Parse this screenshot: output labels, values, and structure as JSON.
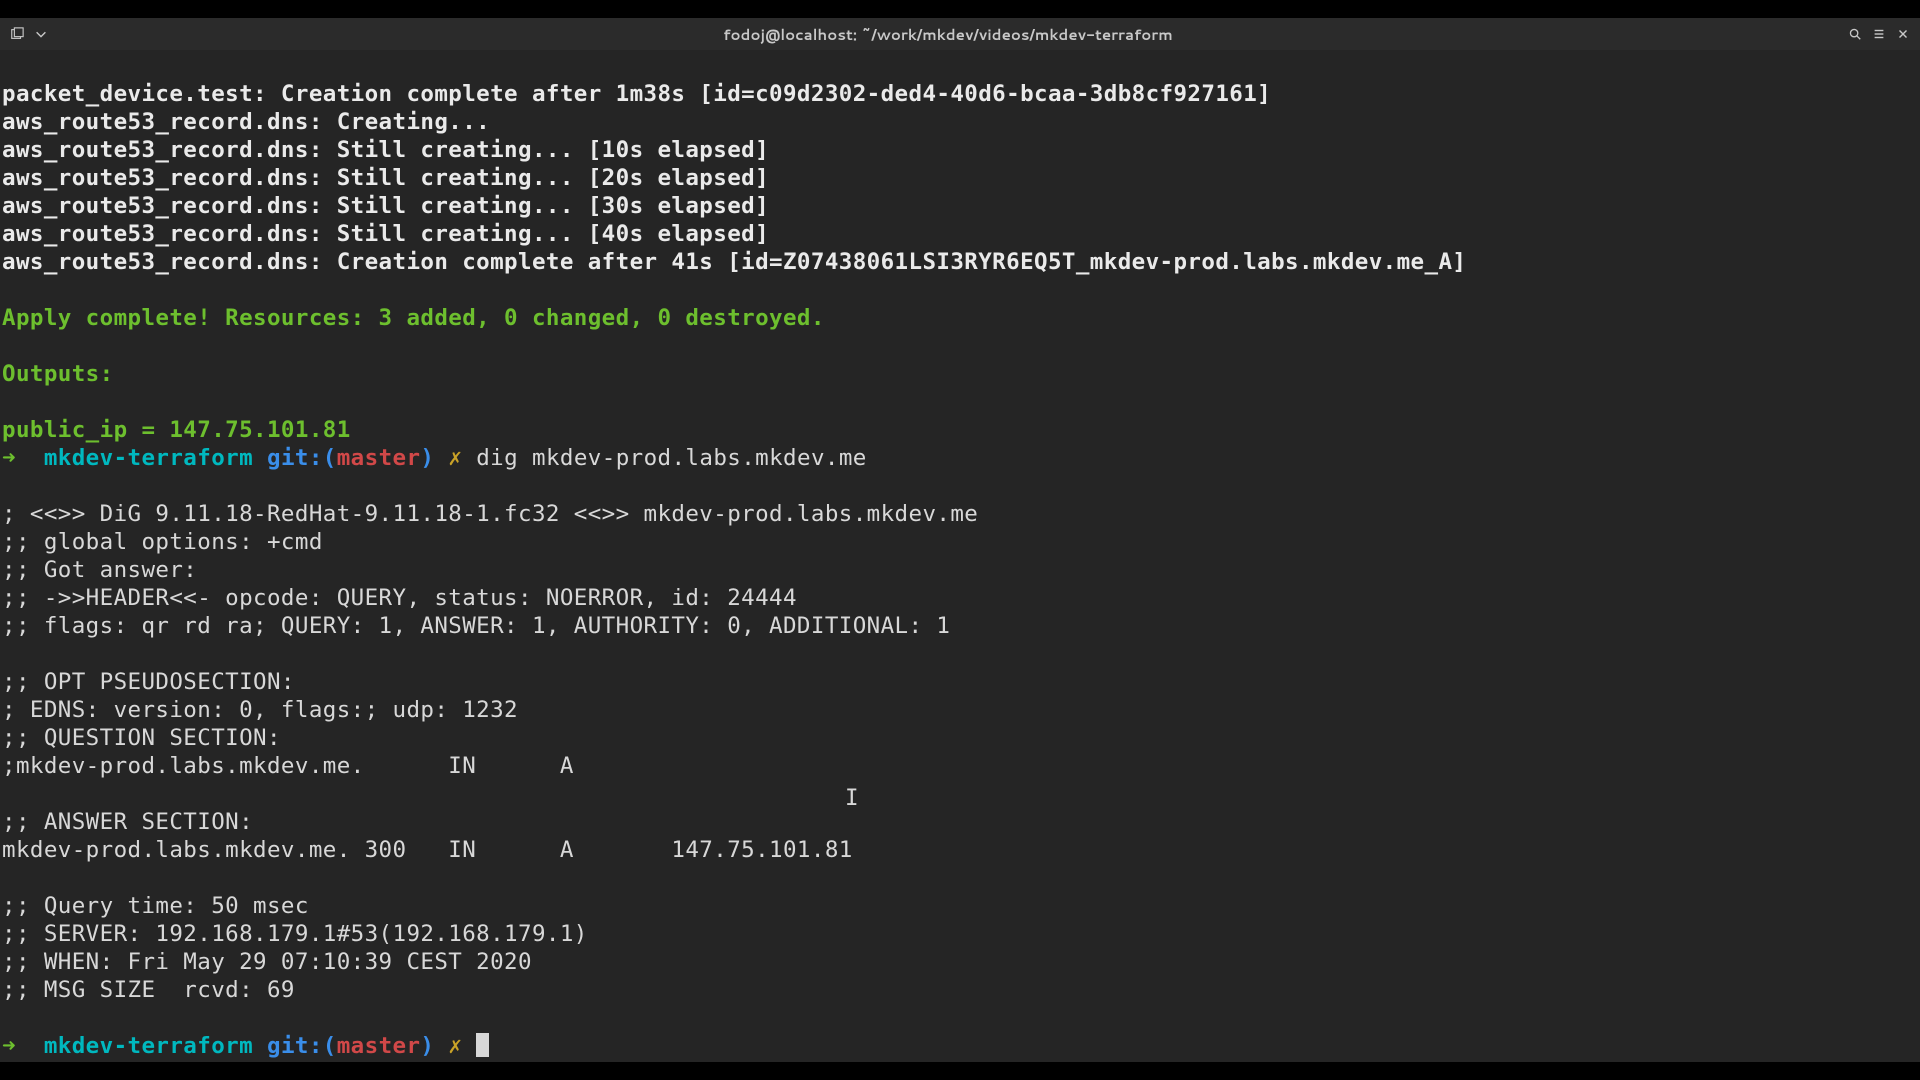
{
  "titlebar": {
    "title": "fodoj@localhost: ~/work/mkdev/videos/mkdev-terraform"
  },
  "out": {
    "l1": "packet_device.test: Creation complete after 1m38s [id=c09d2302-ded4-40d6-bcaa-3db8cf927161]",
    "l2": "aws_route53_record.dns: Creating...",
    "l3": "aws_route53_record.dns: Still creating... [10s elapsed]",
    "l4": "aws_route53_record.dns: Still creating... [20s elapsed]",
    "l5": "aws_route53_record.dns: Still creating... [30s elapsed]",
    "l6": "aws_route53_record.dns: Still creating... [40s elapsed]",
    "l7": "aws_route53_record.dns: Creation complete after 41s [id=Z07438061LSI3RYR6EQ5T_mkdev-prod.labs.mkdev.me_A]",
    "apply": "Apply complete! Resources: 3 added, 0 changed, 0 destroyed.",
    "outputs": "Outputs:",
    "public_ip": "public_ip = 147.75.101.81",
    "dig_cmd": "dig mkdev-prod.labs.mkdev.me",
    "d1": "; <<>> DiG 9.11.18-RedHat-9.11.18-1.fc32 <<>> mkdev-prod.labs.mkdev.me",
    "d2": ";; global options: +cmd",
    "d3": ";; Got answer:",
    "d4": ";; ->>HEADER<<- opcode: QUERY, status: NOERROR, id: 24444",
    "d5": ";; flags: qr rd ra; QUERY: 1, ANSWER: 1, AUTHORITY: 0, ADDITIONAL: 1",
    "d6": ";; OPT PSEUDOSECTION:",
    "d7": "; EDNS: version: 0, flags:; udp: 1232",
    "d8": ";; QUESTION SECTION:",
    "d9": ";mkdev-prod.labs.mkdev.me.      IN      A",
    "d10": ";; ANSWER SECTION:",
    "d11": "mkdev-prod.labs.mkdev.me. 300   IN      A       147.75.101.81",
    "d12": ";; Query time: 50 msec",
    "d13": ";; SERVER: 192.168.179.1#53(192.168.179.1)",
    "d14": ";; WHEN: Fri May 29 07:10:39 CEST 2020",
    "d15": ";; MSG SIZE  rcvd: 69"
  },
  "prompt": {
    "arrow": "➜  ",
    "dir": "mkdev-terraform",
    "git_label": "git:(",
    "branch": "master",
    "git_close": ")",
    "dirty": "✗"
  }
}
